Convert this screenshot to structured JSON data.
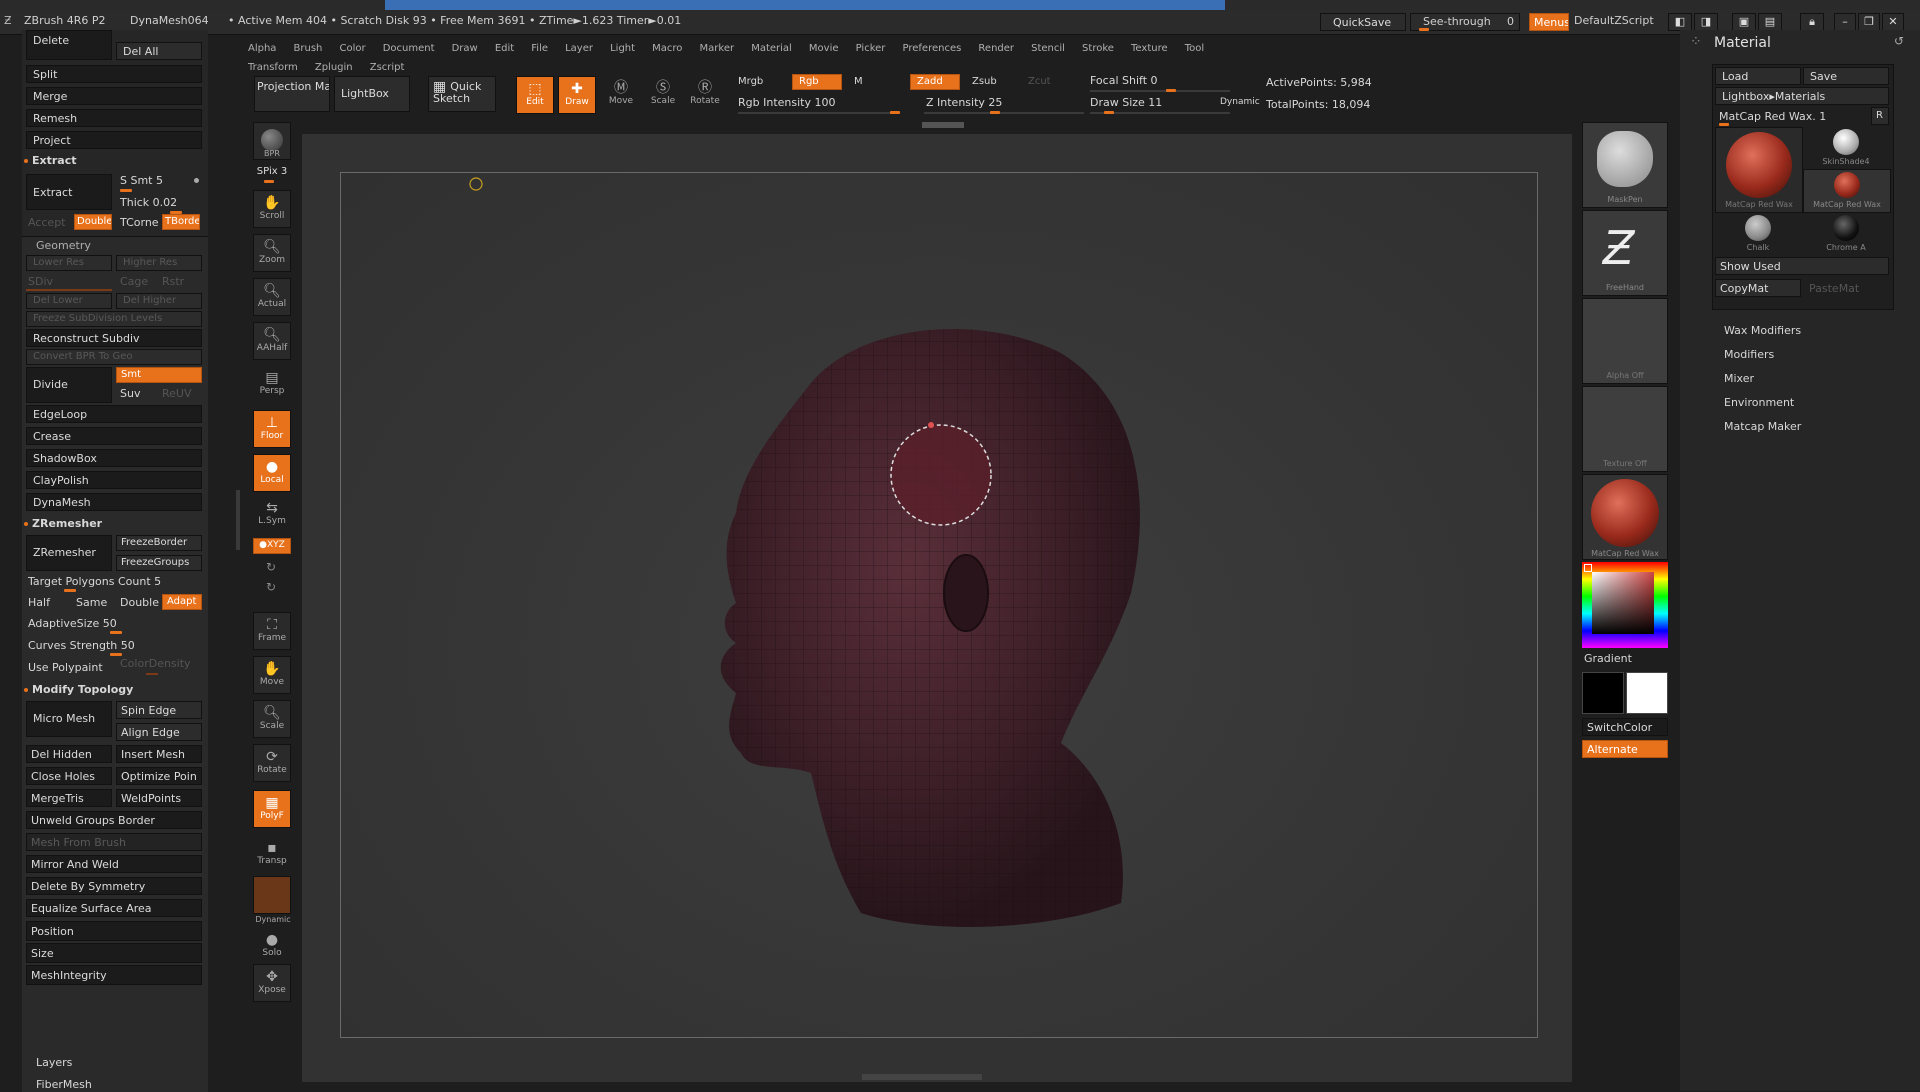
{
  "titlebar": {
    "app_name": "ZBrush 4R6 P2",
    "dynamesh_label": "DynaMesh064",
    "stats": "• Active Mem 404 • Scratch Disk 93 • Free Mem 3691 • ZTime►1.623 Timer►0.01",
    "quicksave": "QuickSave",
    "see_through": "See-through",
    "see_through_value": "0",
    "menus": "Menus",
    "default_zscript": "DefaultZScript"
  },
  "menubar": {
    "items": [
      "Alpha",
      "Brush",
      "Color",
      "Document",
      "Draw",
      "Edit",
      "File",
      "Layer",
      "Light",
      "Macro",
      "Marker",
      "Material",
      "Movie",
      "Picker",
      "Preferences",
      "Render",
      "Stencil",
      "Stroke",
      "Texture",
      "Tool",
      "Transform",
      "Zplugin",
      "Zscript"
    ]
  },
  "toolbar": {
    "projection_master": "Projection Master",
    "lightbox": "LightBox",
    "quick_sketch": "Quick Sketch",
    "edit": "Edit",
    "draw": "Draw",
    "move": "Move",
    "scale": "Scale",
    "rotate": "Rotate",
    "mrgb": "Mrgb",
    "rgb": "Rgb",
    "m": "M",
    "zadd": "Zadd",
    "zsub": "Zsub",
    "zcut": "Zcut",
    "rgb_intensity": "Rgb Intensity 100",
    "z_intensity": "Z Intensity 25",
    "focal_shift": "Focal Shift 0",
    "draw_size": "Draw Size 11",
    "dynamic": "Dynamic",
    "active_points": "ActivePoints: 5,984",
    "total_points": "TotalPoints: 18,094"
  },
  "left_panel": {
    "delete": "Delete",
    "del_all": "Del All",
    "split": "Split",
    "merge": "Merge",
    "remesh": "Remesh",
    "project": "Project",
    "extract_header": "Extract",
    "extract_button": "Extract",
    "s_smt": "S Smt 5",
    "thick": "Thick 0.02",
    "accept": "Accept",
    "double": "Double",
    "tcorne": "TCorne",
    "tborde": "TBorde",
    "geometry": "Geometry",
    "lower_res": "Lower Res",
    "higher_res": "Higher Res",
    "sdiv": "SDiv",
    "cage": "Cage",
    "rstr": "Rstr",
    "del_lower": "Del Lower",
    "del_higher": "Del Higher",
    "freeze_subdiv": "Freeze SubDivision Levels",
    "reconstruct_subdiv": "Reconstruct Subdiv",
    "convert_bpr": "Convert BPR To Geo",
    "divide": "Divide",
    "smt": "Smt",
    "suv": "Suv",
    "reuv": "ReUV",
    "edgeloop": "EdgeLoop",
    "crease": "Crease",
    "shadowbox": "ShadowBox",
    "claypolish": "ClayPolish",
    "dynamesh": "DynaMesh",
    "zremesher_header": "ZRemesher",
    "zremesher_button": "ZRemesher",
    "freeze_border": "FreezeBorder",
    "freeze_groups": "FreezeGroups",
    "target_polygons": "Target Polygons Count 5",
    "half": "Half",
    "same": "Same",
    "double2": "Double",
    "adapt": "Adapt",
    "adaptive_size": "AdaptiveSize 50",
    "curves_strength": "Curves Strength 50",
    "use_polypaint": "Use Polypaint",
    "color_density": "ColorDensity",
    "modify_topology": "Modify Topology",
    "micro_mesh": "Micro Mesh",
    "spin_edge": "Spin Edge",
    "align_edge": "Align Edge",
    "del_hidden": "Del Hidden",
    "insert_mesh": "Insert Mesh",
    "close_holes": "Close Holes",
    "optimize_points": "Optimize Poin",
    "merge_tris": "MergeTris",
    "weld_points": "WeldPoints",
    "unweld_groups": "Unweld Groups Border",
    "mesh_from_brush": "Mesh From Brush",
    "mirror_and_weld": "Mirror And Weld",
    "delete_by_symmetry": "Delete By Symmetry",
    "equalize_surface": "Equalize Surface Area",
    "position": "Position",
    "size": "Size",
    "mesh_integrity": "MeshIntegrity",
    "layers": "Layers",
    "fibermesh": "FiberMesh"
  },
  "right_shelf": {
    "bpr": "BPR",
    "spix": "SPix 3",
    "scroll": "Scroll",
    "zoom": "Zoom",
    "actual": "Actual",
    "aahalf": "AAHalf",
    "persp": "Persp",
    "floor": "Floor",
    "local": "Local",
    "lsym": "L.Sym",
    "xyz": "●XYZ",
    "frame": "Frame",
    "move": "Move",
    "scale": "Scale",
    "rotate": "Rotate",
    "polyf": "PolyF",
    "transp": "Transp",
    "dynamic": "Dynamic",
    "solo": "Solo",
    "xpose": "Xpose"
  },
  "swatches": {
    "maskpen": "MaskPen",
    "freehand": "FreeHand",
    "alpha_off": "Alpha Off",
    "texture_off": "Texture Off",
    "matcap": "MatCap Red Wax",
    "gradient": "Gradient",
    "switch_color": "SwitchColor",
    "alternate": "Alternate"
  },
  "material_panel": {
    "title": "Material",
    "load": "Load",
    "save": "Save",
    "lightbox_materials": "Lightbox▸Materials",
    "current": "MatCap Red Wax. 1",
    "r": "R",
    "mat_big": "MatCap Red Wax",
    "skinshade": "SkinShade4",
    "mat_small": "MatCap Red Wax",
    "chalk": "Chalk",
    "chrome": "Chrome A",
    "show_used": "Show Used",
    "copymat": "CopyMat",
    "pastemat": "PasteMat",
    "sections": [
      "Wax Modifiers",
      "Modifiers",
      "Mixer",
      "Environment",
      "Matcap Maker"
    ]
  },
  "colors": {
    "accent": "#e8721c",
    "bg": "#1e1e1e",
    "canvas": "#3a3a3a"
  }
}
